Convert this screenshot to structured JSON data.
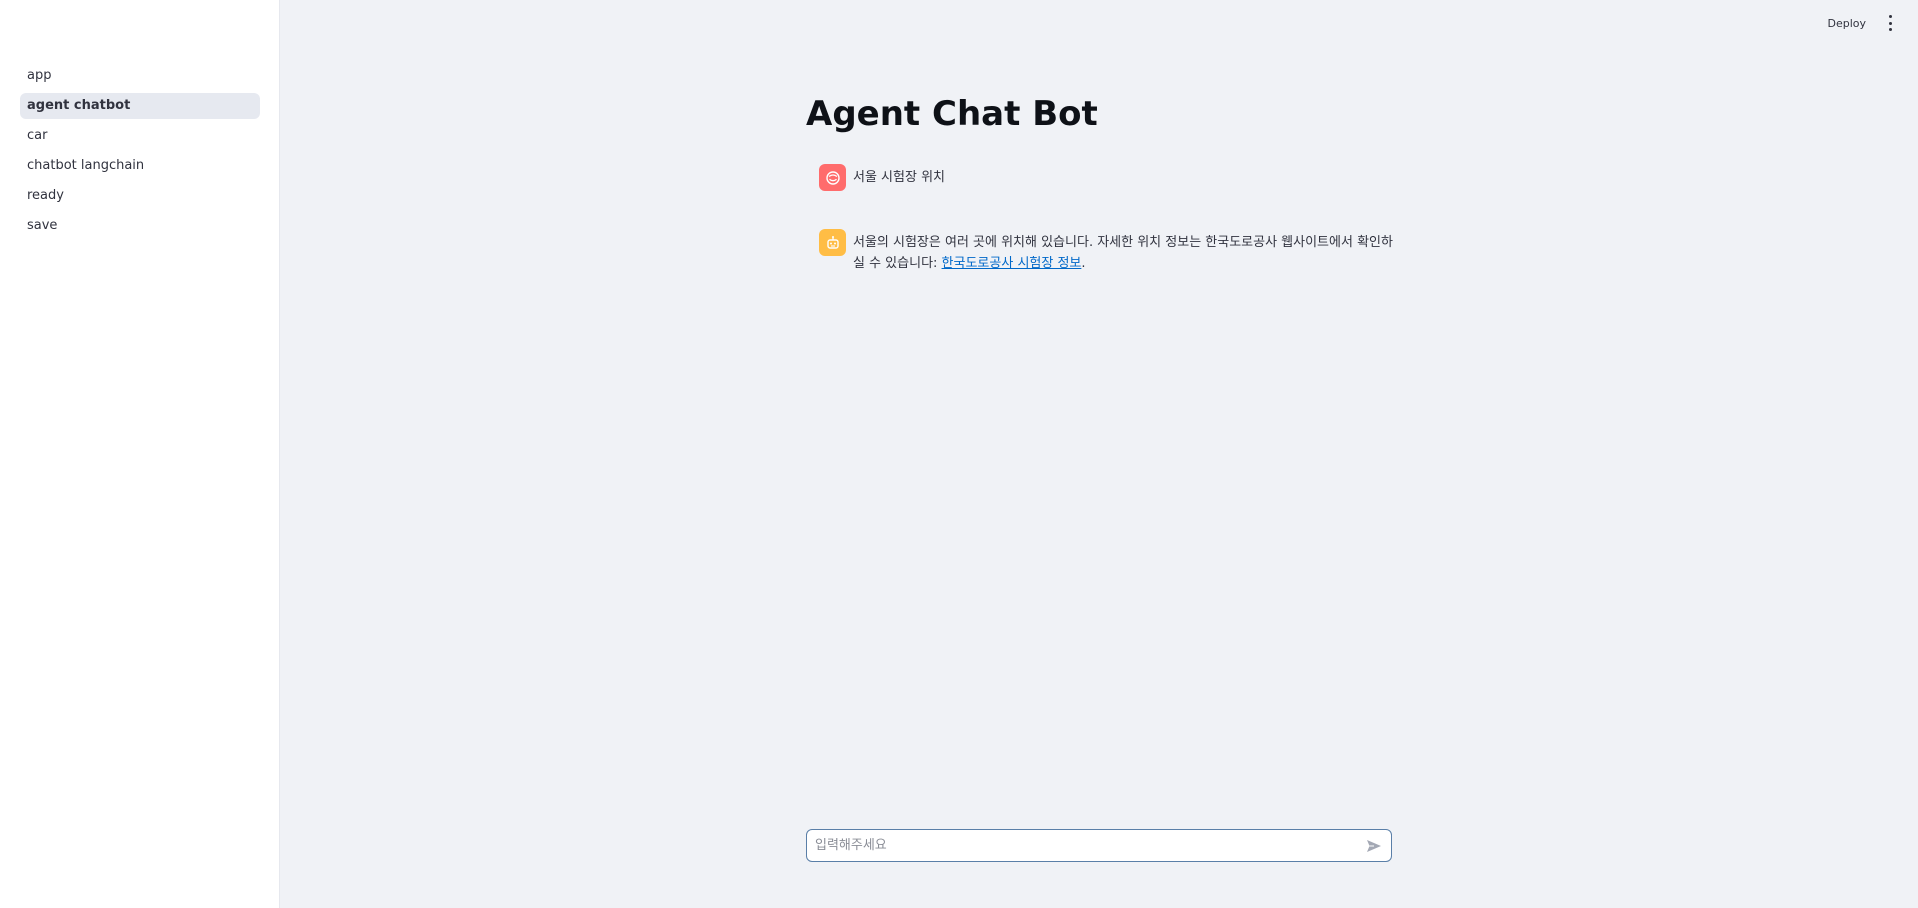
{
  "header": {
    "deploy_label": "Deploy",
    "menu_icon": "kebab-menu-icon"
  },
  "sidebar": {
    "items": [
      {
        "label": "app",
        "active": false
      },
      {
        "label": "agent chatbot",
        "active": true
      },
      {
        "label": "car",
        "active": false
      },
      {
        "label": "chatbot langchain",
        "active": false
      },
      {
        "label": "ready",
        "active": false
      },
      {
        "label": "save",
        "active": false
      }
    ]
  },
  "main": {
    "title": "Agent Chat Bot",
    "messages": [
      {
        "role": "user",
        "avatar_icon": "user-face-icon",
        "avatar_color": "#ff6c6c",
        "text": "서울 시험장 위치"
      },
      {
        "role": "assistant",
        "avatar_icon": "robot-icon",
        "avatar_color": "#ffbd45",
        "text_before": "서울의 시험장은 여러 곳에 위치해 있습니다. 자세한 위치 정보는 한국도로공사 웹사이트에서 확인하실 수 있습니다: ",
        "link_text": "한국도로공사 시험장 정보",
        "text_after": "."
      }
    ]
  },
  "chat_input": {
    "placeholder": "입력해주세요",
    "value": "",
    "send_icon": "send-icon"
  },
  "colors": {
    "accent_link": "#0068c9",
    "sidebar_active_bg": "#e6e9f0",
    "main_bg": "#f0f2f6",
    "input_border": "#5a7fa8"
  }
}
